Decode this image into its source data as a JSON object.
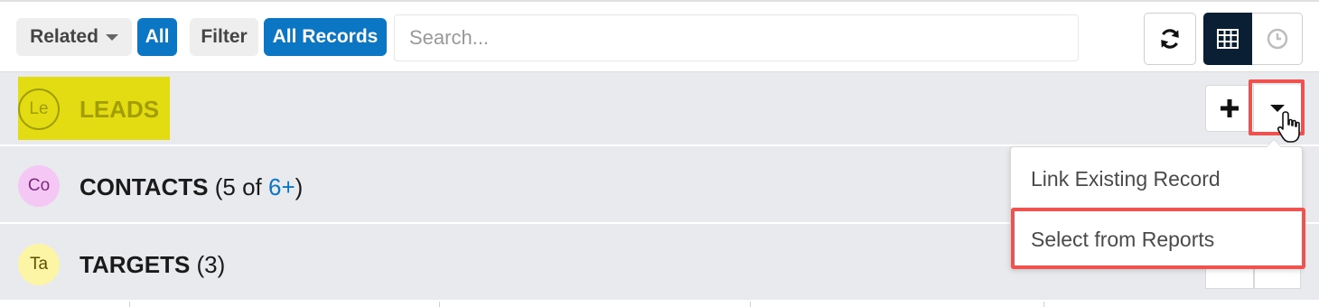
{
  "filter_bar": {
    "related_label": "Related",
    "related_value": "All",
    "filter_label": "Filter",
    "filter_value": "All Records",
    "search_placeholder": "Search..."
  },
  "toolbar": {
    "refresh_icon": "refresh-icon",
    "table_icon": "table-icon",
    "clock_icon": "clock-icon"
  },
  "subpanels": {
    "leads": {
      "avatar": "Le",
      "title": "LEADS"
    },
    "contacts": {
      "avatar": "Co",
      "title": "CONTACTS",
      "count_prefix": " (5 of ",
      "count_link": "6+",
      "count_suffix": ")"
    },
    "targets": {
      "avatar": "Ta",
      "title": "TARGETS",
      "count": " (3)"
    }
  },
  "actions": {
    "add_icon": "plus-icon",
    "menu_icon": "caret-down-icon"
  },
  "dropdown": {
    "items": [
      {
        "label": "Link Existing Record"
      },
      {
        "label": "Select from Reports"
      }
    ]
  },
  "colors": {
    "accent_blue": "#0b76c4",
    "highlight_yellow": "#e3dc12",
    "callout_red": "#ef5350",
    "dark_navy": "#0a1f33"
  }
}
